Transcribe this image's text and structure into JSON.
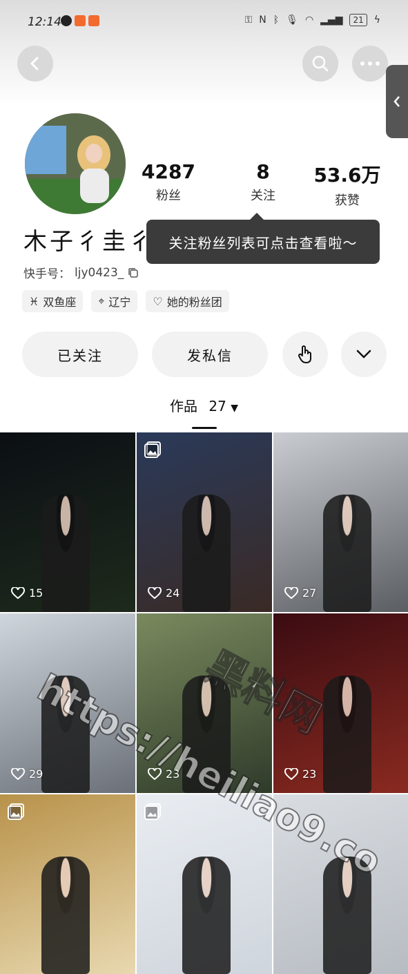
{
  "status_bar": {
    "time": "12:14",
    "battery": "21"
  },
  "profile": {
    "name": "木子彳圭彳乐",
    "kuaishou_id_label": "快手号：",
    "kuaishou_id": "ljy0423_",
    "stats": [
      {
        "value": "4287",
        "label": "粉丝"
      },
      {
        "value": "8",
        "label": "关注"
      },
      {
        "value": "53.6万",
        "label": "获赞"
      }
    ],
    "tooltip": "关注粉丝列表可点击查看啦～",
    "tags": [
      {
        "icon": "pisces-icon",
        "label": "双鱼座"
      },
      {
        "icon": "location-pin-icon",
        "label": "辽宁"
      },
      {
        "icon": "heart-icon",
        "label": "她的粉丝团"
      }
    ]
  },
  "actions": {
    "followed_label": "已关注",
    "message_label": "发私信"
  },
  "works_tab": {
    "label": "作品",
    "count": "27"
  },
  "grid": [
    {
      "likes": "15",
      "multi": false,
      "bg": [
        "#0b0f14",
        "#1e2a1c"
      ]
    },
    {
      "likes": "24",
      "multi": true,
      "bg": [
        "#2a3a5a",
        "#3a2a25"
      ]
    },
    {
      "likes": "27",
      "multi": false,
      "bg": [
        "#c9cdd2",
        "#5a5e62"
      ]
    },
    {
      "likes": "29",
      "multi": false,
      "bg": [
        "#cfd6dc",
        "#6b7078"
      ]
    },
    {
      "likes": "23",
      "multi": false,
      "bg": [
        "#7a8a5e",
        "#2f3b2a"
      ]
    },
    {
      "likes": "23",
      "multi": false,
      "bg": [
        "#3a0c12",
        "#8a2a20"
      ]
    },
    {
      "likes": "",
      "multi": true,
      "bg": [
        "#b8924a",
        "#e8d8b0"
      ]
    },
    {
      "likes": "",
      "multi": true,
      "bg": [
        "#e9edf2",
        "#cfd5dc"
      ]
    },
    {
      "likes": "",
      "multi": false,
      "bg": [
        "#d9dde2",
        "#b7bcc2"
      ]
    }
  ],
  "watermark": {
    "text1": "黑料网",
    "text2": "https://heiliao9.co"
  }
}
